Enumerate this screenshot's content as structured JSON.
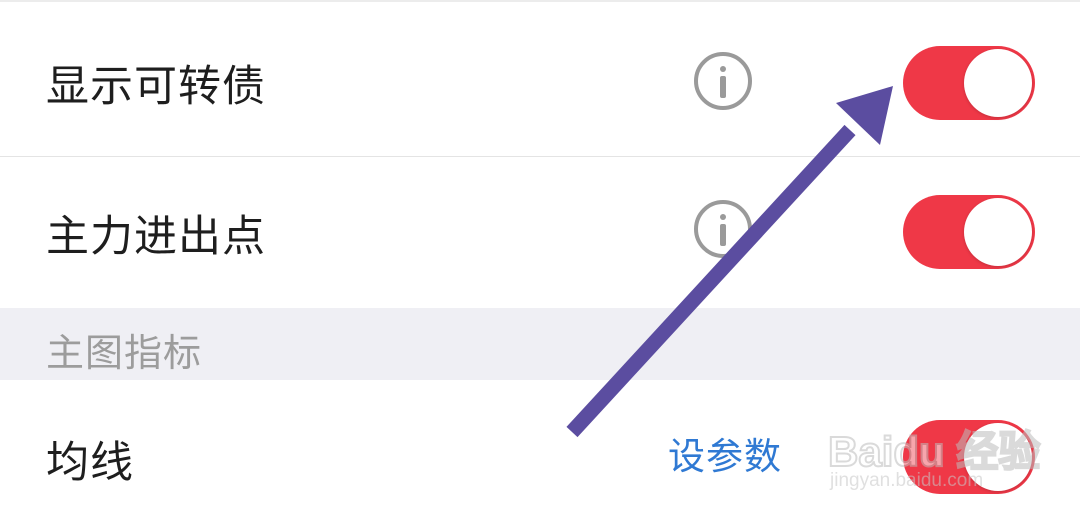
{
  "settings": {
    "rows": [
      {
        "label": "显示可转债",
        "info_icon": "info-circle-icon",
        "toggle_on": true
      },
      {
        "label": "主力进出点",
        "info_icon": "info-circle-icon",
        "toggle_on": true
      }
    ],
    "section_header": "主图指标",
    "ma_row": {
      "label": "均线",
      "param_link": "设参数",
      "toggle_on": true
    }
  },
  "annotation": {
    "type": "arrow",
    "color": "#5b4da0",
    "points_to": "显示可转债 toggle"
  },
  "watermark": {
    "brand": "Baidu 经验",
    "url": "jingyan.baidu.com"
  },
  "colors": {
    "toggle_on": "#ef3847",
    "link": "#2f79d3",
    "section_bg": "#efeff4",
    "arrow": "#5b4da0"
  }
}
